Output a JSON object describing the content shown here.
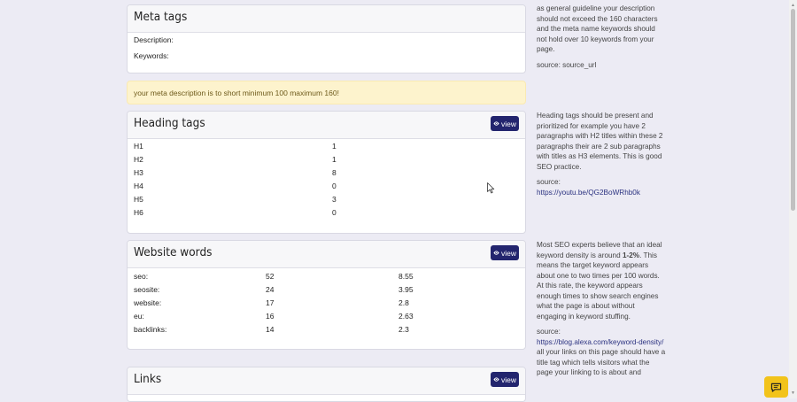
{
  "meta_tags": {
    "title": "Meta tags",
    "description_label": "Description:",
    "keywords_label": "Keywords:"
  },
  "alert": "your meta description is to short minimum 100 maximum 160!",
  "heading_tags": {
    "title": "Heading tags",
    "view_label": "view",
    "rows": [
      {
        "tag": "H1",
        "count": "1"
      },
      {
        "tag": "H2",
        "count": "1"
      },
      {
        "tag": "H3",
        "count": "8"
      },
      {
        "tag": "H4",
        "count": "0"
      },
      {
        "tag": "H5",
        "count": "3"
      },
      {
        "tag": "H6",
        "count": "0"
      }
    ]
  },
  "website_words": {
    "title": "Website words",
    "view_label": "view",
    "rows": [
      {
        "word": "seo:",
        "count": "52",
        "density": "8.55"
      },
      {
        "word": "seosite:",
        "count": "24",
        "density": "3.95"
      },
      {
        "word": "website:",
        "count": "17",
        "density": "2.8"
      },
      {
        "word": "eu:",
        "count": "16",
        "density": "2.63"
      },
      {
        "word": "backlinks:",
        "count": "14",
        "density": "2.3"
      }
    ]
  },
  "links": {
    "title": "Links",
    "view_label": "view"
  },
  "side": {
    "meta": {
      "text": "as general guideline your description should not exceed the 160 characters and the meta name keywords should not hold over 10 keywords from your page.",
      "source": "source: source_url"
    },
    "heading": {
      "text": "Heading tags should be present and prioritized for example you have 2 paragraphs with H2 titles within these 2 paragraphs their are 2 sub paragraphs with titles as H3 elements. This is good SEO practice.",
      "source_label": "source:",
      "source_link": "https://youtu.be/QG2BoWRhb0k"
    },
    "words": {
      "text_before": "Most SEO experts believe that an ideal keyword density is around ",
      "text_bold": "1-2%",
      "text_after": ". This means the target keyword appears about one to two times per 100 words. At this rate, the keyword appears enough times to show search engines what the page is about without engaging in keyword stuffing.",
      "source_label": "source:",
      "source_link": "https://blog.alexa.com/keyword-density/"
    },
    "links": {
      "text": "all your links on this page should have a title tag which tells visitors what the page your linking to is about and"
    }
  }
}
